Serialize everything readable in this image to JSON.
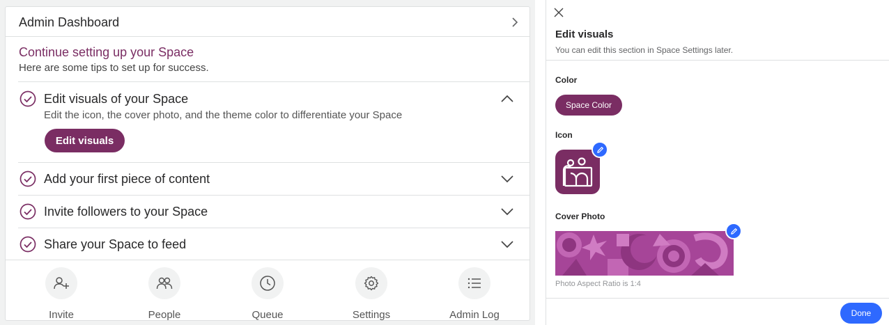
{
  "dashboard": {
    "title": "Admin Dashboard",
    "chevron_icon": "chevron-right-icon"
  },
  "setup": {
    "title": "Continue setting up your Space",
    "subtitle": "Here are some tips to set up for success."
  },
  "steps": [
    {
      "label": "Edit visuals of your Space",
      "description": "Edit the icon, the cover photo, and the theme color to differentiate your Space",
      "button": "Edit visuals",
      "expanded": true,
      "icon": "check-circle-icon"
    },
    {
      "label": "Add your first piece of content",
      "expanded": false,
      "icon": "check-circle-icon"
    },
    {
      "label": "Invite followers to your Space",
      "expanded": false,
      "icon": "check-circle-icon"
    },
    {
      "label": "Share your Space to feed",
      "expanded": false,
      "icon": "check-circle-icon"
    }
  ],
  "footer": [
    {
      "label": "Invite",
      "icon": "add-user-icon"
    },
    {
      "label": "People",
      "icon": "people-icon"
    },
    {
      "label": "Queue",
      "icon": "clock-icon"
    },
    {
      "label": "Settings",
      "icon": "gear-icon"
    },
    {
      "label": "Admin Log",
      "icon": "list-icon"
    }
  ],
  "panel": {
    "close_icon": "close-icon",
    "title": "Edit visuals",
    "subtitle": "You can edit this section in Space Settings later.",
    "color_label": "Color",
    "color_button": "Space Color",
    "icon_label": "Icon",
    "cover_label": "Cover Photo",
    "aspect_note": "Photo Aspect Ratio is 1:4",
    "done_button": "Done"
  },
  "colors": {
    "brand": "#7a2d63",
    "accent": "#2e69ff",
    "cover": "#a64598"
  }
}
